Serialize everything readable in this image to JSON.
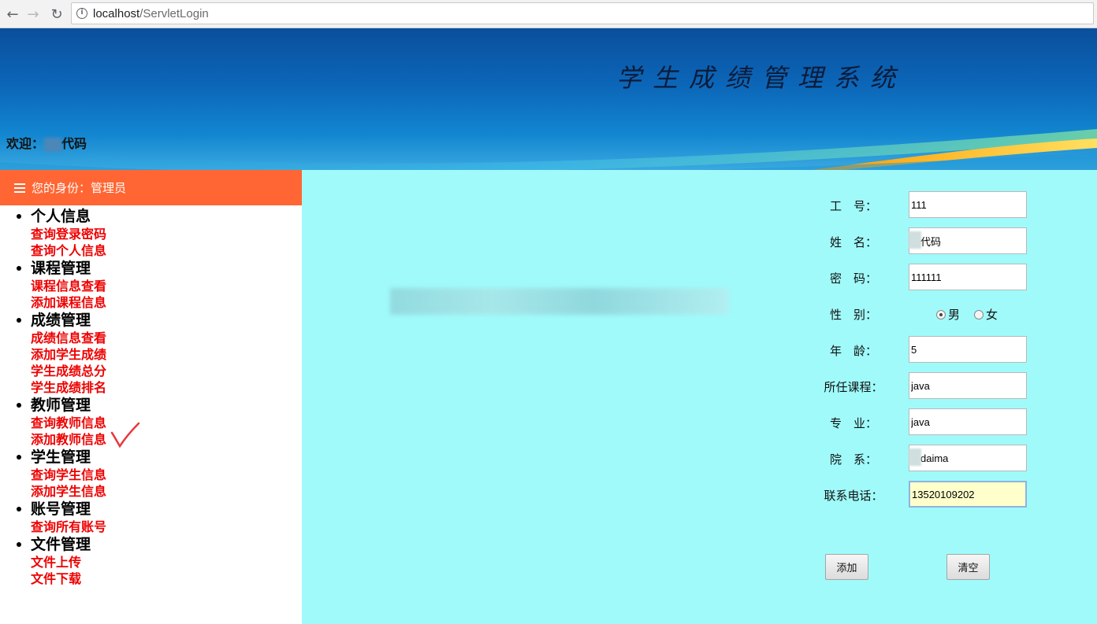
{
  "browser": {
    "url_host": "localhost",
    "url_path": "/ServletLogin"
  },
  "banner": {
    "title": "学生成绩管理系统",
    "welcome_prefix": "欢迎：",
    "welcome_name": "代码"
  },
  "sidebar": {
    "role_text": "您的身份：管理员",
    "groups": [
      {
        "title": "个人信息",
        "links": [
          "查询登录密码",
          "查询个人信息"
        ]
      },
      {
        "title": "课程管理",
        "links": [
          "课程信息查看",
          "添加课程信息"
        ]
      },
      {
        "title": "成绩管理",
        "links": [
          "成绩信息查看",
          "添加学生成绩",
          "学生成绩总分",
          "学生成绩排名"
        ]
      },
      {
        "title": "教师管理",
        "links": [
          "查询教师信息",
          "添加教师信息"
        ]
      },
      {
        "title": "学生管理",
        "links": [
          "查询学生信息",
          "添加学生信息"
        ]
      },
      {
        "title": "账号管理",
        "links": [
          "查询所有账号"
        ]
      },
      {
        "title": "文件管理",
        "links": [
          "文件上传",
          "文件下载"
        ]
      }
    ]
  },
  "form": {
    "id_label": "工　号：",
    "id_value": "111",
    "name_label": "姓　名：",
    "name_value": "代码",
    "password_label": "密　码：",
    "password_value": "111111",
    "gender_label": "性　别：",
    "gender_male": "男",
    "gender_female": "女",
    "age_label": "年　龄：",
    "age_value": "5",
    "course_label": "所任课程：",
    "course_value": "java",
    "major_label": "专　业：",
    "major_value": "java",
    "dept_label": "院　系：",
    "dept_value": "daima",
    "phone_label": "联系电话：",
    "phone_value": "13520109202",
    "add_button": "添加",
    "clear_button": "清空"
  },
  "colors": {
    "role_bar": "#ff6633",
    "link_red": "#ee0000",
    "main_bg": "#a0fafa"
  }
}
